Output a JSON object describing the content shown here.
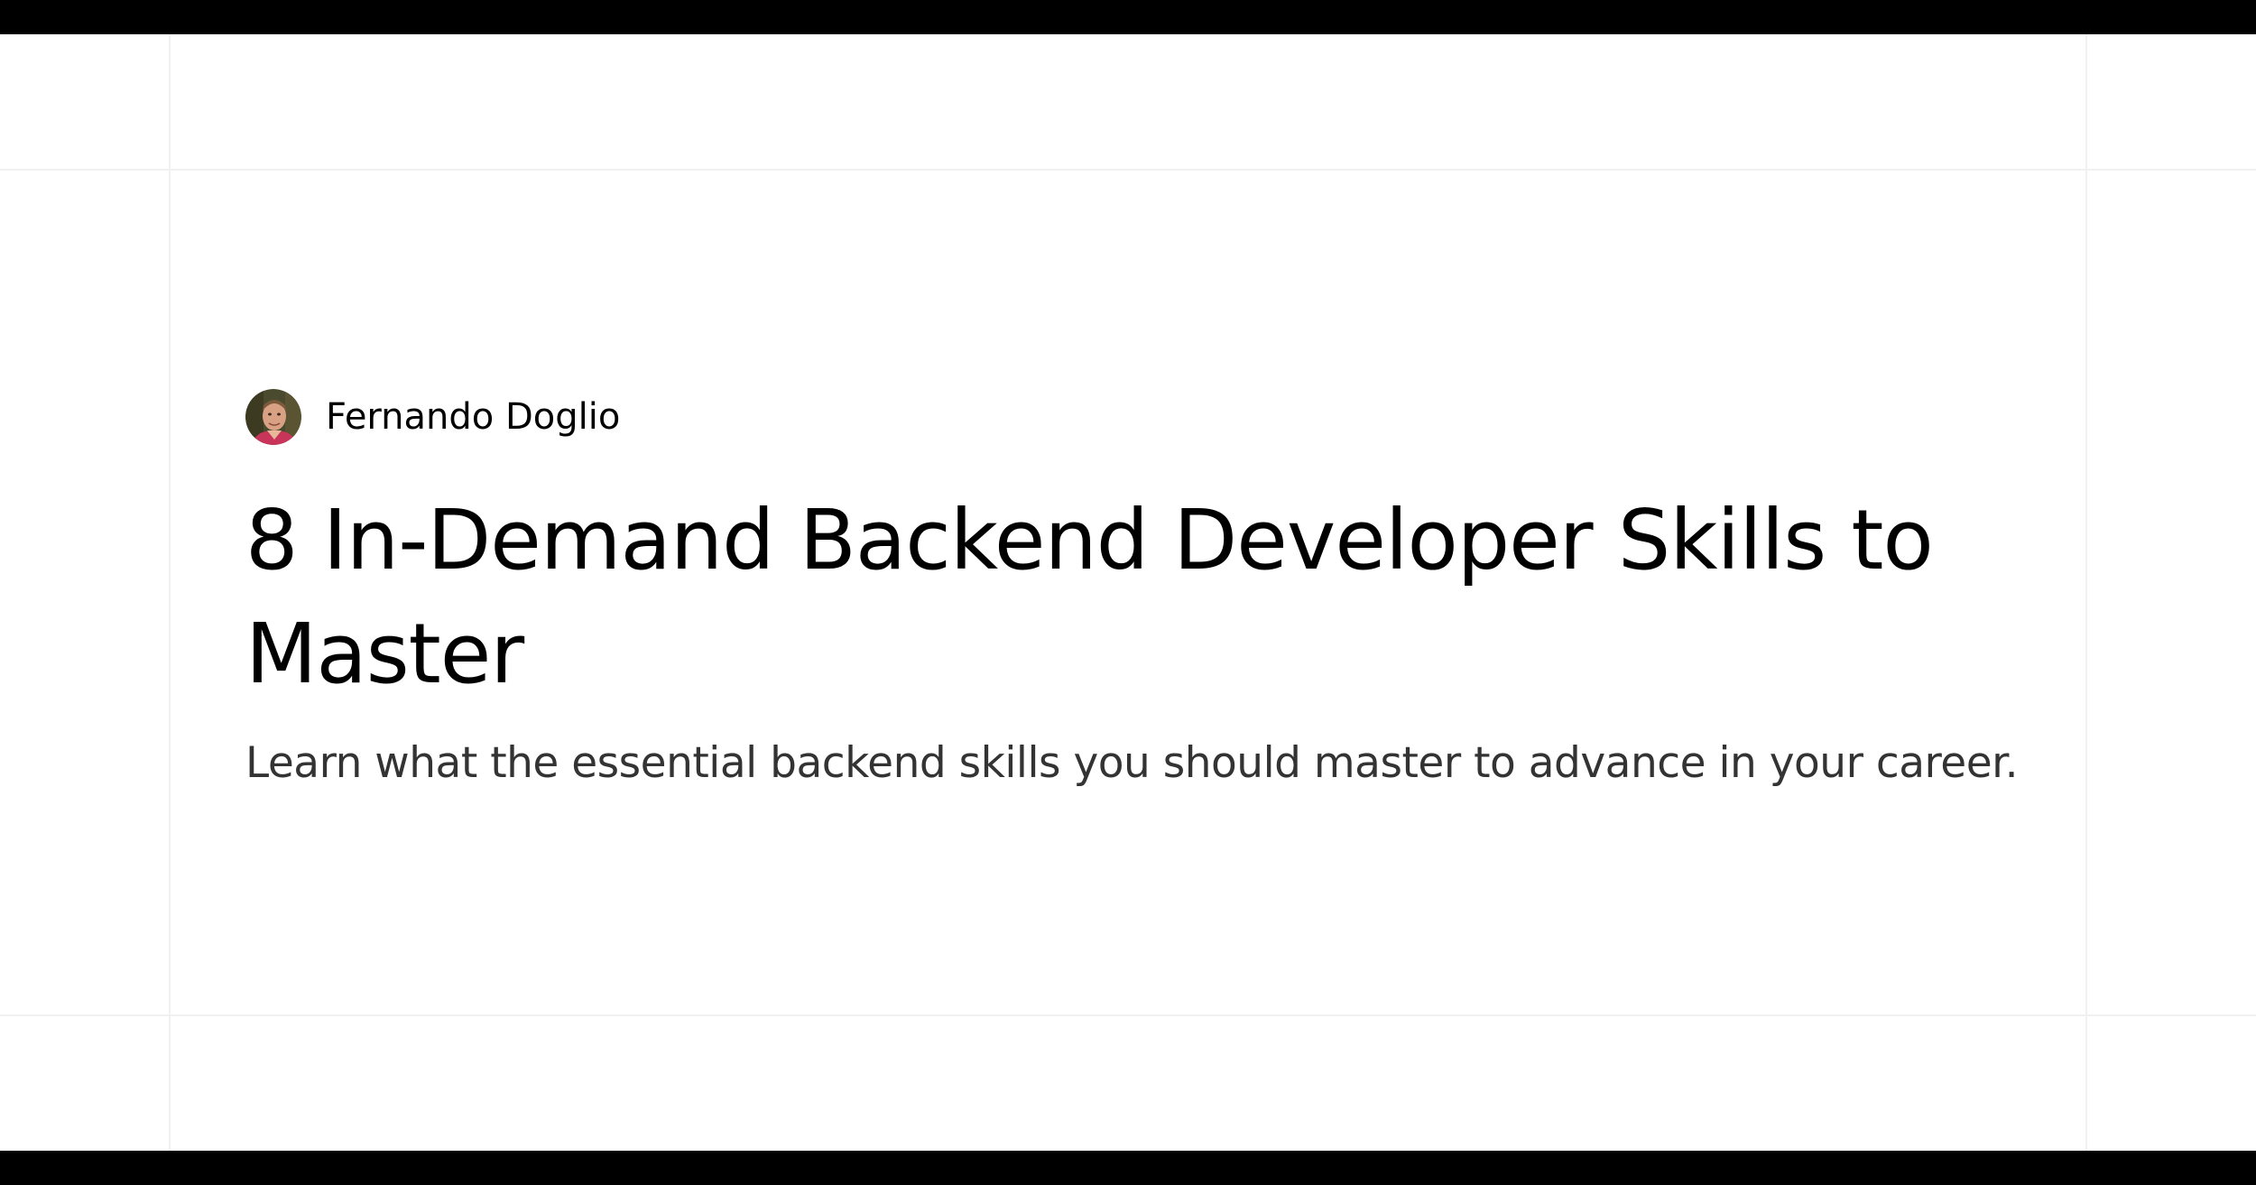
{
  "author": {
    "name": "Fernando Doglio",
    "avatar_icon": "author-avatar-photo"
  },
  "article": {
    "title": "8 In-Demand Backend Developer Skills to Master",
    "subtitle": "Learn what the essential backend skills you should master to advance in your career."
  },
  "colors": {
    "frame_bar": "#000000",
    "background": "#ffffff",
    "grid_lines": "#f1f1f1",
    "title_text": "#000000",
    "subtitle_text": "#333333"
  }
}
